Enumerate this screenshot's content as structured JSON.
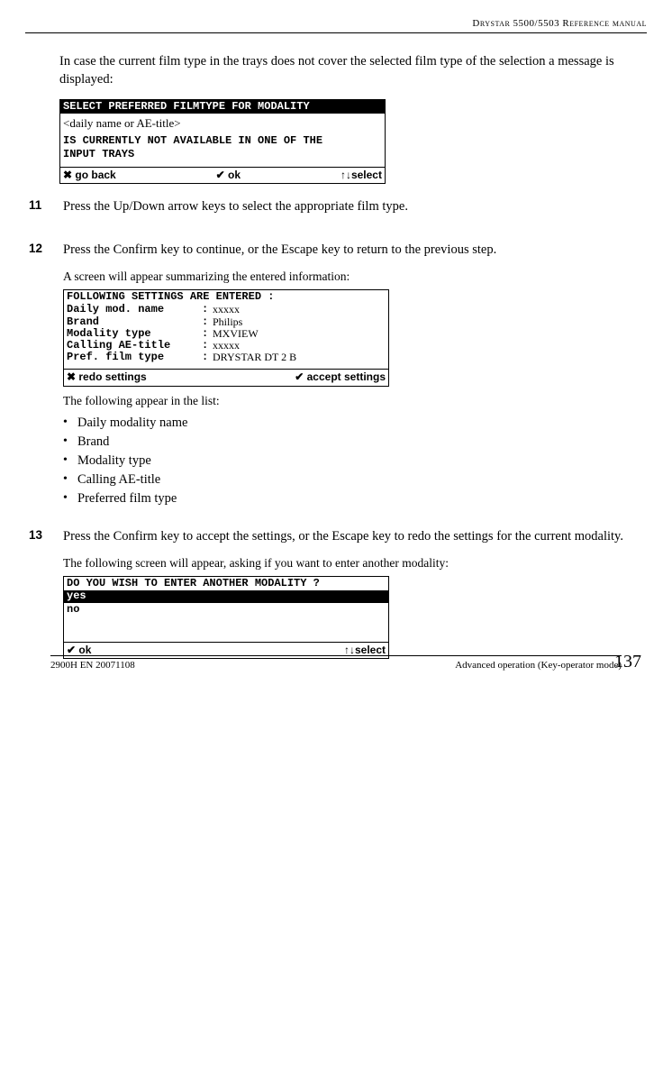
{
  "header": {
    "title": "Drystar 5500/5503 Reference manual"
  },
  "intro": "In case the current film type in the trays does not cover the selected film type of the selection a message is displayed:",
  "lcd1": {
    "title": "SELECT PREFERRED FILMTYPE FOR MODALITY",
    "placeholder": "<daily name or AE-title>",
    "body1": "IS CURRENTLY NOT AVAILABLE IN ONE OF THE",
    "body2": "INPUT TRAYS",
    "status_left": "✖ go back",
    "status_mid": "✔ ok",
    "status_right": "↑↓select"
  },
  "steps": {
    "s11": {
      "num": "11",
      "text": "Press the Up/Down arrow keys to select the appropriate film type."
    },
    "s12": {
      "num": "12",
      "text": "Press the Confirm key to continue, or the Escape key to return to the previous step.",
      "sub": "A screen will appear summarizing the entered information:"
    },
    "s13": {
      "num": "13",
      "text": "Press the Confirm key to accept the settings, or the Escape key to redo the settings for the current modality.",
      "sub": "The following screen will appear, asking if you want to enter another modality:"
    }
  },
  "lcd2": {
    "title": "FOLLOWING SETTINGS ARE ENTERED :",
    "rows": [
      {
        "label": "Daily mod. name",
        "val": "xxxxx"
      },
      {
        "label": "Brand",
        "val": "Philips"
      },
      {
        "label": "Modality type",
        "val": "MXVIEW"
      },
      {
        "label": "Calling AE-title",
        "val": "xxxxx"
      },
      {
        "label": "Pref. film type",
        "val": "DRYSTAR DT 2 B"
      }
    ],
    "status_left": "✖ redo settings",
    "status_right": "✔ accept settings"
  },
  "list_intro": "The following appear in the list:",
  "list_items": [
    "Daily modality name",
    "Brand",
    "Modality type",
    "Calling AE-title",
    "Preferred film type"
  ],
  "lcd3": {
    "title": "DO YOU WISH TO ENTER ANOTHER MODALITY ?",
    "opt_sel": "yes",
    "opt2": "no",
    "status_left": "✔ ok",
    "status_right": "↑↓select"
  },
  "footer": {
    "left": "2900H EN 20071108",
    "right": "Advanced operation (Key-operator mode)",
    "page": "137"
  }
}
